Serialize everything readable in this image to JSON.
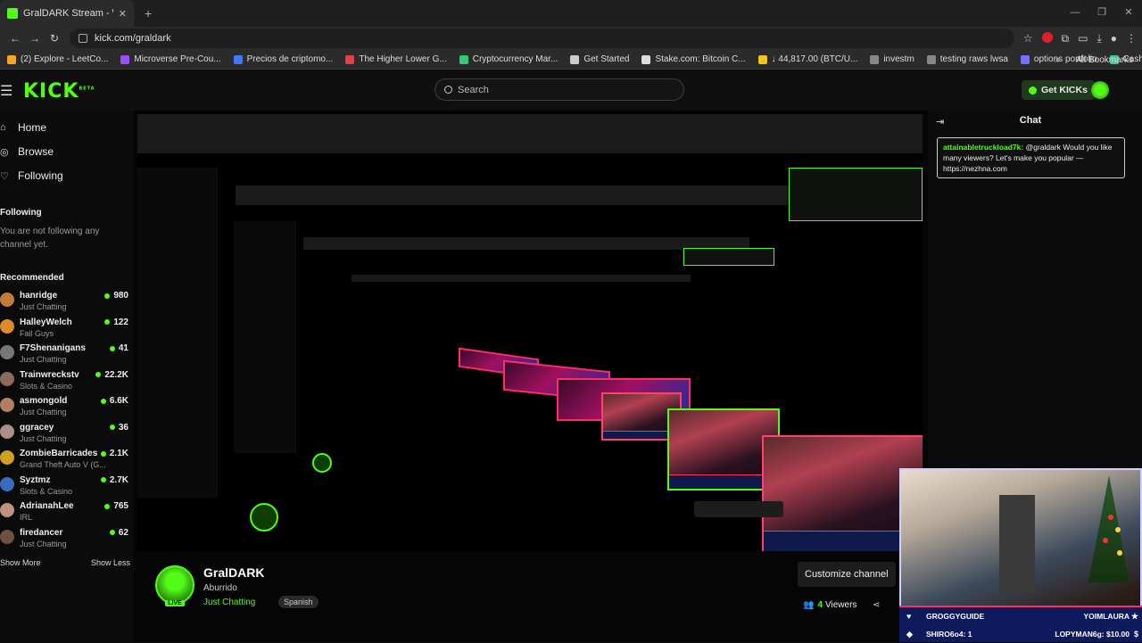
{
  "browser": {
    "tab_title": "GralDARK Stream - Watch Live",
    "tab_close": "✕",
    "new_tab": "+",
    "window_controls": [
      "—",
      "❐",
      "✕"
    ],
    "url": "kick.com/graldark",
    "bookmarks": [
      {
        "label": "(2) Explore - LeetCo...",
        "icon_color": "#f5a623"
      },
      {
        "label": "Microverse Pre-Cou...",
        "icon_color": "#9b4dff"
      },
      {
        "label": "Precios de criptomo...",
        "icon_color": "#3a7bff"
      },
      {
        "label": "The Higher Lower G...",
        "icon_color": "#e04040"
      },
      {
        "label": "Cryptocurrency Mar...",
        "icon_color": "#2ecc71"
      },
      {
        "label": "Get Started",
        "icon_color": "#cccccc"
      },
      {
        "label": "Stake.com: Bitcoin C...",
        "icon_color": "#dddddd"
      },
      {
        "label": "↓ 44,817.00 (BTC/U...",
        "icon_color": "#f5c518"
      },
      {
        "label": "investm",
        "icon_color": "#888888"
      },
      {
        "label": "testing raws lwsa",
        "icon_color": "#888888"
      },
      {
        "label": "options portfolio",
        "icon_color": "#7a6cff"
      },
      {
        "label": "Cash Payment | Offi...",
        "icon_color": "#44c4a1"
      }
    ],
    "bookmarks_overflow": "»",
    "all_bookmarks": "All Bookmarks"
  },
  "header": {
    "logo": "KICK",
    "logo_sup": "BETA",
    "search_placeholder": "Search",
    "get_kicks": "Get KICKs"
  },
  "sidebar": {
    "nav": [
      {
        "label": "Home",
        "icon": "⌂"
      },
      {
        "label": "Browse",
        "icon": "◎"
      },
      {
        "label": "Following",
        "icon": "♡"
      }
    ],
    "following_title": "Following",
    "following_empty": "You are not following any channel yet.",
    "recommended_title": "Recommended",
    "recommended": [
      {
        "name": "hanridge",
        "category": "Just Chatting",
        "viewers": "980",
        "color": "#c47a3a"
      },
      {
        "name": "HalleyWelch",
        "category": "Fall Guys",
        "viewers": "122",
        "color": "#e08a2a"
      },
      {
        "name": "F7Shenanigans",
        "category": "Just Chatting",
        "viewers": "41",
        "color": "#777777"
      },
      {
        "name": "Trainwreckstv",
        "category": "Slots & Casino",
        "viewers": "22.2K",
        "color": "#8a6a5a"
      },
      {
        "name": "asmongold",
        "category": "Just Chatting",
        "viewers": "6.6K",
        "color": "#b08060"
      },
      {
        "name": "ggracey",
        "category": "Just Chatting",
        "viewers": "36",
        "color": "#aa9088"
      },
      {
        "name": "ZombieBarricades",
        "category": "Grand Theft Auto V (G...",
        "viewers": "2.1K",
        "color": "#d0a020"
      },
      {
        "name": "Syztmz",
        "category": "Slots & Casino",
        "viewers": "2.7K",
        "color": "#3a6ac0"
      },
      {
        "name": "AdrianahLee",
        "category": "IRL",
        "viewers": "765",
        "color": "#c09080"
      },
      {
        "name": "firedancer",
        "category": "Just Chatting",
        "viewers": "62",
        "color": "#705040"
      }
    ],
    "show_more": "Show More",
    "show_less": "Show Less"
  },
  "channel": {
    "name": "GralDARK",
    "title": "Aburrido",
    "category": "Just Chatting",
    "tag": "Spanish",
    "live_badge": "LIVE",
    "customize": "Customize channel",
    "viewers_count": "4",
    "viewers_label": "Viewers"
  },
  "chat": {
    "title": "Chat",
    "messages": [
      {
        "user": "attainabletruckload7k:",
        "text": "@graldark Would you like many viewers? Let's make you popular — https://nezhna.com"
      }
    ]
  },
  "overlay": {
    "left_top": "GROGGYGUIDE",
    "right_top": "YOIMLAURA",
    "left_bottom": "SHIRO6o4: 1",
    "right_bottom": "LOPYMAN6g: $10.00"
  }
}
